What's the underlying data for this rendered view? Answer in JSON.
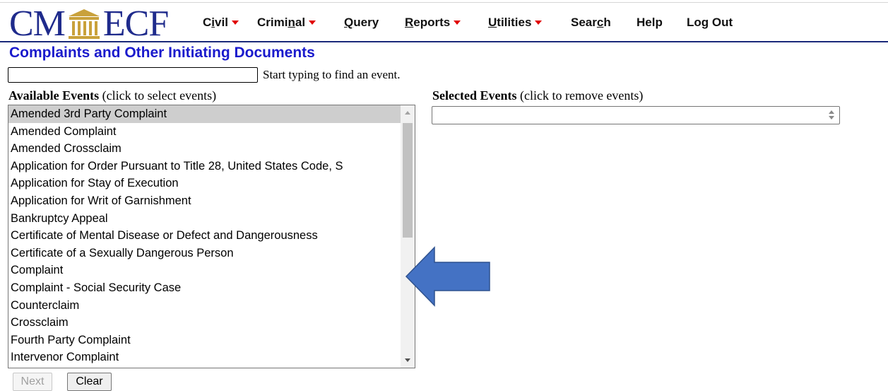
{
  "logo": {
    "left_text": "CM",
    "right_text": "ECF"
  },
  "menu": {
    "civil": {
      "pre": "C",
      "u": "i",
      "post": "vil"
    },
    "criminal": {
      "pre": "Crimi",
      "u": "n",
      "post": "al"
    },
    "query": {
      "pre": "",
      "u": "Q",
      "post": "uery"
    },
    "reports": {
      "pre": "",
      "u": "R",
      "post": "eports"
    },
    "utilities": {
      "pre": "",
      "u": "U",
      "post": "tilities"
    },
    "search": {
      "pre": "Sear",
      "u": "c",
      "post": "h"
    },
    "help": "Help",
    "logout": "Log Out"
  },
  "page_title": "Complaints and Other Initiating Documents",
  "search": {
    "value": "",
    "hint": "Start typing to find an event."
  },
  "available": {
    "heading_bold": "Available Events",
    "heading_rest": " (click to select events)",
    "items": [
      "Amended 3rd Party Complaint",
      "Amended Complaint",
      "Amended Crossclaim",
      "Application for Order Pursuant to Title 28, United States Code, S",
      "Application for Stay of Execution",
      "Application for Writ of Garnishment",
      "Bankruptcy Appeal",
      "Certificate of Mental Disease or Defect and Dangerousness",
      "Certificate of a Sexually Dangerous Person",
      "Complaint",
      "Complaint - Social Security Case",
      "Counterclaim",
      "Crossclaim",
      "Fourth Party Complaint",
      "Intervenor Complaint"
    ],
    "selected_index": 0
  },
  "selected": {
    "heading_bold": "Selected Events",
    "heading_rest": " (click to remove events)"
  },
  "buttons": {
    "next": "Next",
    "clear": "Clear"
  },
  "colors": {
    "brand": "#1f2b8c",
    "title": "#1a1acc",
    "caret": "#e00000",
    "arrow": "#4472c4"
  }
}
